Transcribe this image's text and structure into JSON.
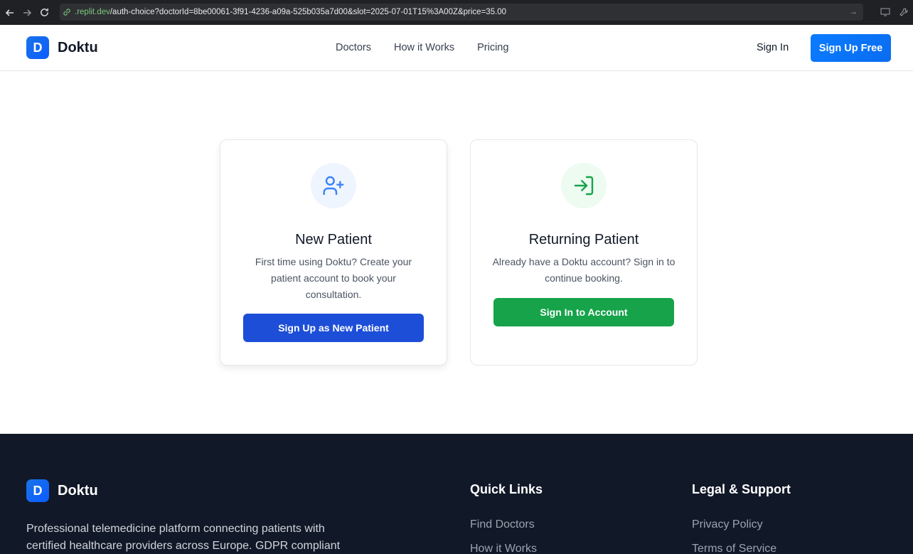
{
  "browser": {
    "url_host": ".replit.dev",
    "url_path": "/auth-choice?doctorId=8be00061-3f91-4236-a09a-525b035a7d00&slot=2025-07-01T15%3A00Z&price=35.00"
  },
  "header": {
    "logo_letter": "D",
    "brand": "Doktu",
    "nav": [
      "Doctors",
      "How it Works",
      "Pricing"
    ],
    "sign_in": "Sign In",
    "sign_up": "Sign Up Free"
  },
  "cards": {
    "new_patient": {
      "icon": "user-plus-icon",
      "title": "New Patient",
      "description": "First time using Doktu? Create your patient account to book your consultation.",
      "button": "Sign Up as New Patient"
    },
    "returning_patient": {
      "icon": "log-in-icon",
      "title": "Returning Patient",
      "description": "Already have a Doktu account? Sign in to continue booking.",
      "button": "Sign In to Account"
    }
  },
  "footer": {
    "logo_letter": "D",
    "brand": "Doktu",
    "description": "Professional telemedicine platform connecting patients with certified healthcare providers across Europe. GDPR compliant",
    "quick_links": {
      "title": "Quick Links",
      "items": [
        "Find Doctors",
        "How it Works"
      ]
    },
    "legal": {
      "title": "Legal & Support",
      "items": [
        "Privacy Policy",
        "Terms of Service"
      ]
    }
  },
  "colors": {
    "primary_blue": "#1d4ed8",
    "accent_blue": "#0a84ff",
    "green": "#16a34a",
    "footer_bg": "#111827"
  }
}
